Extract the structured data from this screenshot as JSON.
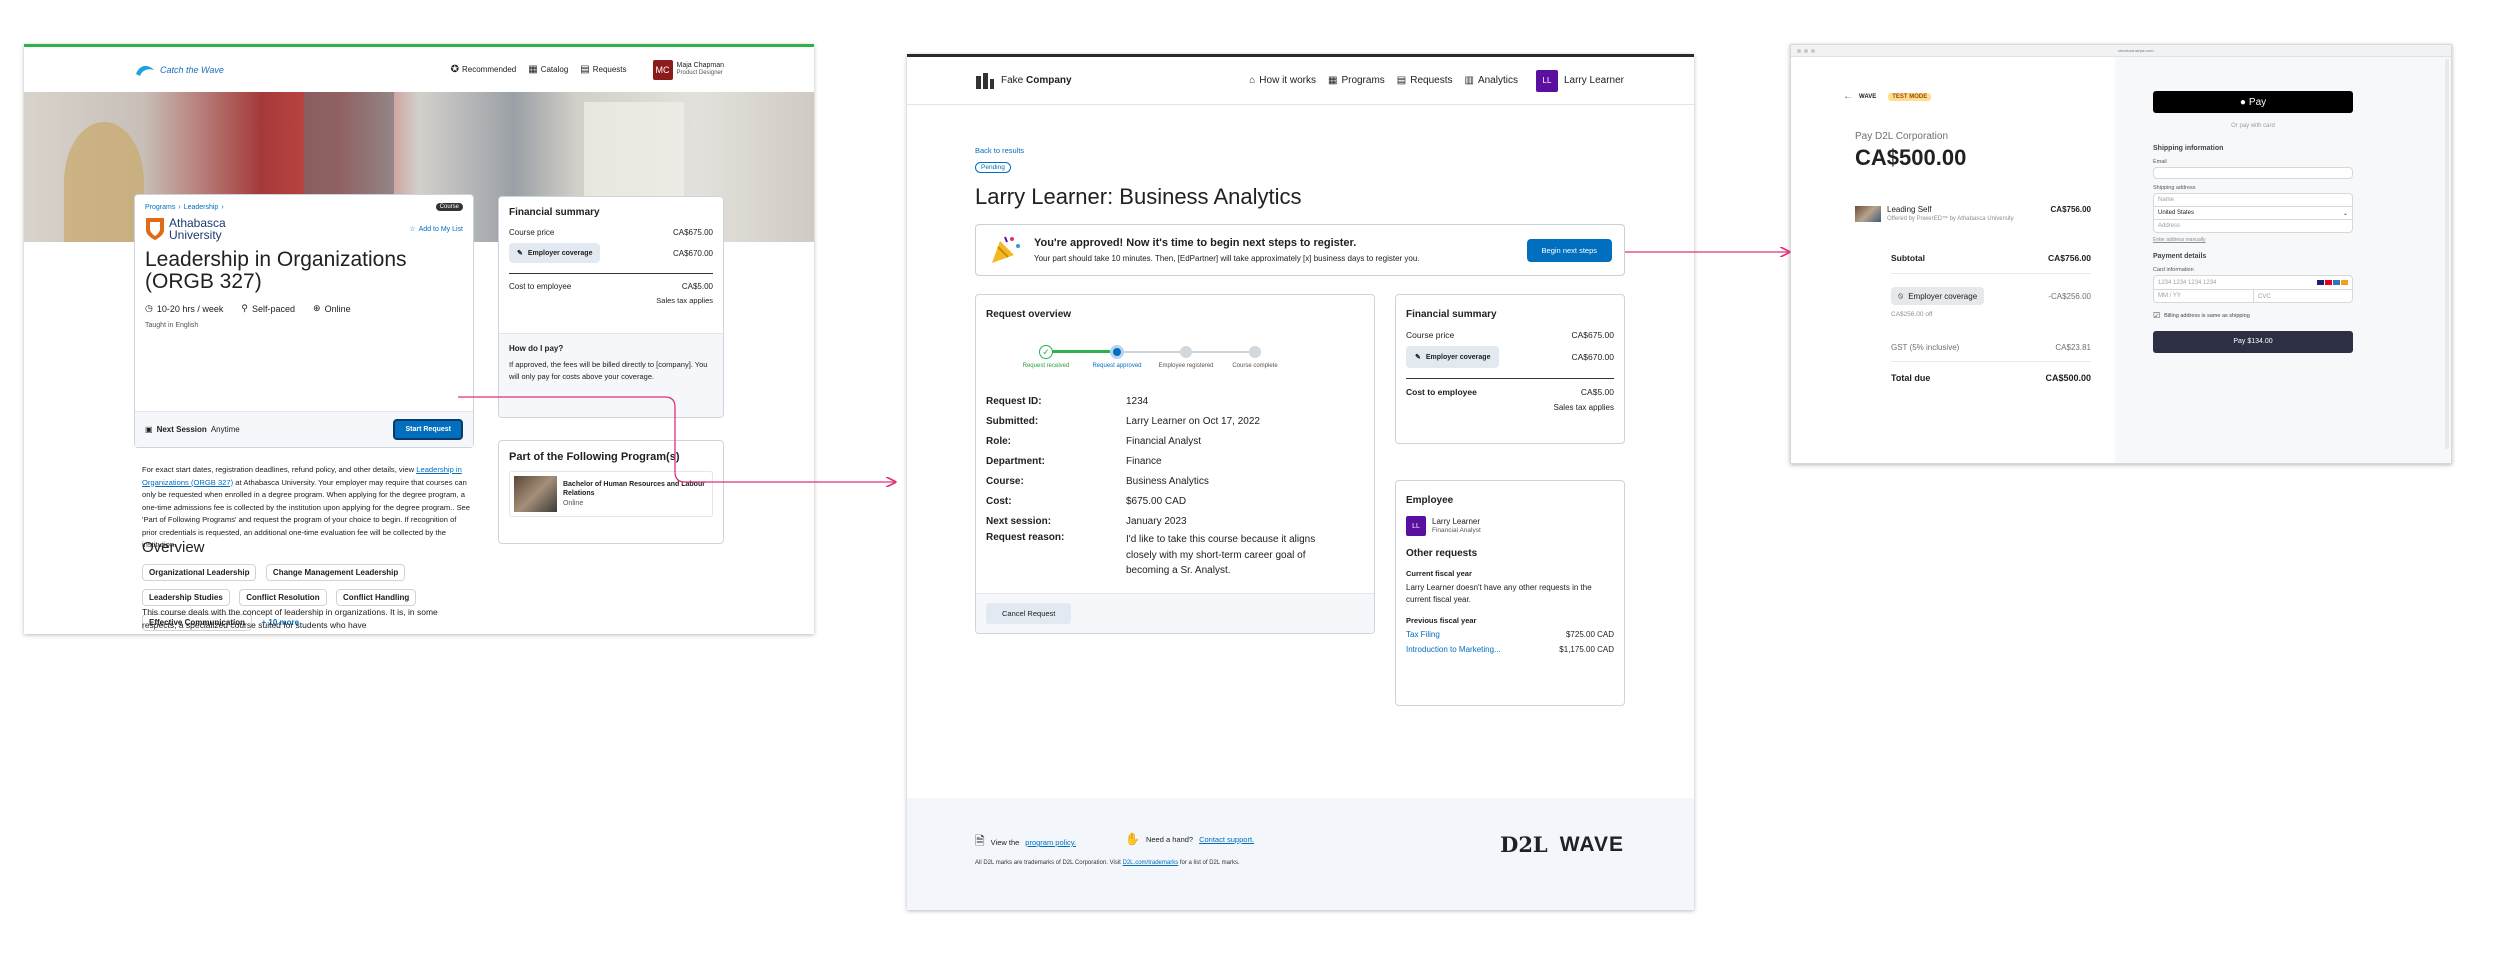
{
  "frame1": {
    "brand": "Catch the Wave",
    "nav": [
      "Recommended",
      "Catalog",
      "Requests"
    ],
    "user": {
      "initials": "MC",
      "name": "Maja Chapman",
      "role": "Product Designer"
    },
    "breadcrumb": [
      "Programs",
      "Leadership"
    ],
    "type_badge": "Course",
    "provider_name": "Athabasca University",
    "add_to_list": "Add to My List",
    "course_title": "Leadership in Organizations (ORGB 327)",
    "meta": {
      "hours": "10-20 hrs / week",
      "pace": "Self-paced",
      "mode": "Online"
    },
    "language": "Taught in English",
    "next_session_label": "Next Session",
    "next_session_value": "Anytime",
    "start_request": "Start Request",
    "description": {
      "p1": "For exact start dates, registration deadlines, refund policy, and other details, view",
      "link": "Leadership in Organizations (ORGB 327)",
      "p2": "at Athabasca University. Your employer may require that courses can only be requested when enrolled in a degree program. When applying for the degree program, a one-time admissions fee is collected by the institution upon applying for the degree program.. See 'Part of Following Programs' and request the program of your choice to begin. If recognition of prior credentials is requested, an additional one-time evaluation fee will be collected by the institution."
    },
    "overview_title": "Overview",
    "skills": [
      "Organizational Leadership",
      "Change Management Leadership",
      "Leadership Studies",
      "Conflict Resolution",
      "Conflict Handling",
      "Effective Communication"
    ],
    "more_skills": "+ 10 more",
    "overview_text": "This course deals with the concept of leadership in organizations. It is, in some respects, a specialized course suited for students who have",
    "financial": {
      "title": "Financial summary",
      "course_price_label": "Course price",
      "course_price": "CA$675.00",
      "coverage_label": "Employer coverage",
      "coverage": "CA$670.00",
      "cost_label": "Cost to employee",
      "cost": "CA$5.00",
      "tax_note": "Sales tax applies",
      "how_title": "How do I pay?",
      "how_text_1": "If approved, the fees will be billed directly to",
      "how_text_2": "[company]. You will only pay for costs above your coverage."
    },
    "programs": {
      "title": "Part of the Following Program(s)",
      "item_title": "Bachelor of Human Resources and Labour Relations",
      "item_mode": "Online"
    }
  },
  "frame2": {
    "brand_light": "Fake",
    "brand_bold": "Company",
    "nav": [
      "How it works",
      "Programs",
      "Requests",
      "Analytics"
    ],
    "user": {
      "initials": "LL",
      "name": "Larry Learner"
    },
    "back_link": "Back to results",
    "status": "Pending",
    "title": "Larry Learner: Business Analytics",
    "banner": {
      "heading": "You're approved! Now it's time to begin next steps to register.",
      "text": "Your part should take 10 minutes. Then, [EdPartner] will take approximately [x] business days to register you.",
      "button": "Begin next steps"
    },
    "overview": {
      "title": "Request overview",
      "steps": [
        "Request received",
        "Request approved",
        "Employee registered",
        "Course complete"
      ],
      "completed_steps": 2,
      "fields": [
        {
          "label": "Request ID:",
          "value": "1234"
        },
        {
          "label": "Submitted:",
          "value": "Larry Learner on Oct 17, 2022"
        },
        {
          "label": "Role:",
          "value": "Financial Analyst"
        },
        {
          "label": "Department:",
          "value": "Finance"
        },
        {
          "label": "Course:",
          "value": "Business Analytics"
        },
        {
          "label": "Cost:",
          "value": "$675.00 CAD"
        },
        {
          "label": "Next session:",
          "value": "January 2023"
        },
        {
          "label": "Request reason:",
          "value": "I'd like to take this course because it aligns closely with my short-term career goal of becoming a Sr. Analyst."
        }
      ],
      "cancel": "Cancel Request"
    },
    "financial": {
      "title": "Financial summary",
      "course_price_label": "Course price",
      "course_price": "CA$675.00",
      "coverage_label": "Employer coverage",
      "coverage": "CA$670.00",
      "cost_label": "Cost to employee",
      "cost": "CA$5.00",
      "tax_note": "Sales tax applies"
    },
    "employee": {
      "title": "Employee",
      "initials": "LL",
      "name": "Larry Learner",
      "role": "Financial Analyst",
      "other_title": "Other requests",
      "current_label": "Current fiscal year",
      "current_text": "Larry Learner doesn't have any other requests in the current fiscal year.",
      "previous_label": "Previous fiscal year",
      "previous": [
        {
          "name": "Tax Filing",
          "amount": "$725.00 CAD"
        },
        {
          "name": "Introduction to Marketing...",
          "amount": "$1,175.00 CAD"
        }
      ]
    },
    "footer": {
      "policy_pre": "View the",
      "policy_link": "program policy.",
      "hand_pre": "Need a hand?",
      "hand_link": "Contact support.",
      "trademark_pre": "All D2L marks are trademarks of D2L Corporation. Visit",
      "trademark_link": "D2L.com/trademarks",
      "trademark_post": "for a list of D2L marks.",
      "logo_d2l": "D2L",
      "logo_wave": "WAVE"
    }
  },
  "frame3": {
    "url": "checkout.stripe.com",
    "logo": "WAVE",
    "test_mode": "TEST MODE",
    "pay_to": "Pay D2L Corporation",
    "amount": "CA$500.00",
    "item": {
      "name": "Leading Self",
      "sub": "Offered by PowerED™ by Athabasca University",
      "price": "CA$756.00"
    },
    "subtotal_label": "Subtotal",
    "subtotal": "CA$756.00",
    "coverage_label": "Employer coverage",
    "coverage_sub": "CA$256.00 off",
    "coverage": "-CA$256.00",
    "gst_label": "GST (5% inclusive)",
    "gst": "CA$23.81",
    "total_label": "Total due",
    "total": "CA$500.00",
    "apple_pay": "Pay",
    "or_card": "Or pay with card",
    "shipping_title": "Shipping information",
    "email_label": "Email",
    "shipping_label": "Shipping address",
    "name_placeholder": "Name",
    "country": "United States",
    "address_placeholder": "Address",
    "enter_manually": "Enter address manually",
    "payment_title": "Payment details",
    "card_label": "Card information",
    "card_placeholder": "1234 1234 1234 1234",
    "expiry_placeholder": "MM / YY",
    "cvc_placeholder": "CVC",
    "billing_same": "Billing address is same as shipping",
    "pay_button": "Pay $134.00"
  },
  "colors": {
    "accent_blue": "#006fbf",
    "arrow_pink": "#e0307c",
    "purple": "#5a0f9e",
    "green_bar": "#2bb34a",
    "dark_red": "#8c1b1b"
  }
}
